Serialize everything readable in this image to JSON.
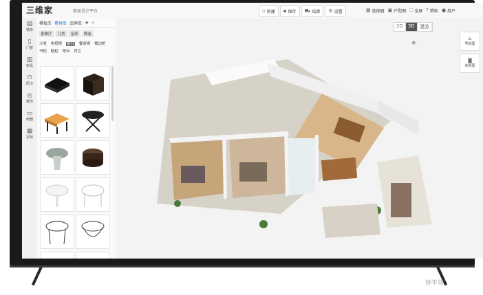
{
  "app": {
    "logo": "三维家",
    "subtitle": "家居设计平台"
  },
  "toolbar": [
    {
      "icon": "file-icon",
      "label": "新建"
    },
    {
      "icon": "save-icon",
      "label": "保存"
    },
    {
      "icon": "cart-icon",
      "label": "结算"
    },
    {
      "icon": "gear-icon",
      "label": "设置"
    }
  ],
  "toolbar_right": [
    {
      "icon": "grid-icon",
      "label": "选择器"
    },
    {
      "icon": "image-icon",
      "label": "户型图"
    },
    {
      "icon": "fullscreen-icon",
      "label": "全屏"
    },
    {
      "icon": "help-icon",
      "label": "帮助"
    },
    {
      "icon": "user-icon",
      "label": "用户"
    }
  ],
  "panel": {
    "tabs": [
      "模板库",
      "素材库",
      "品牌库"
    ],
    "filters": [
      "客餐厅",
      "几类",
      "全部",
      "筛选"
    ],
    "categories": [
      "沙发",
      "电视柜",
      "茶几",
      "餐桌椅",
      "餐边柜",
      "书柜",
      "鞋柜",
      "吧台",
      "其它"
    ],
    "active_category": "茶几"
  },
  "left_rail": [
    "墙体",
    "门窗",
    "家具",
    "厨卫",
    "装饰",
    "电器",
    "定制"
  ],
  "view": {
    "modes": [
      "2D",
      "3D",
      "漫游"
    ],
    "active": "3D"
  },
  "right_rail": [
    "导航图",
    "效果图"
  ],
  "watermark": "钟平坊"
}
